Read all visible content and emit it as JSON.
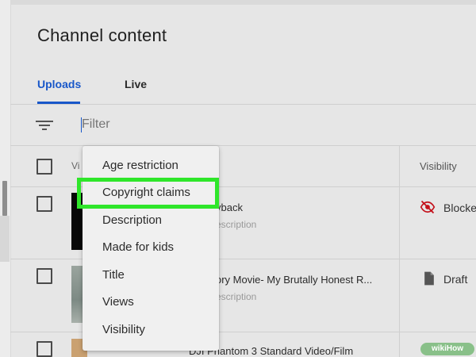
{
  "page": {
    "title": "Channel content"
  },
  "tabs": [
    {
      "label": "Uploads",
      "active": true
    },
    {
      "label": "Live",
      "active": false
    }
  ],
  "filter": {
    "placeholder": "Filter"
  },
  "table": {
    "headers": {
      "video": "Vi",
      "visibility": "Visibility"
    },
    "rows": [
      {
        "title": "yback",
        "description": "escription",
        "visibility": "Blocke",
        "visibility_icon": "eye-off-icon"
      },
      {
        "title": "ory Movie- My Brutally Honest R...",
        "description": "escription",
        "visibility": "Draft",
        "visibility_icon": "document-icon"
      },
      {
        "title": "DJI Phantom 3 Standard Video/Film",
        "description": "",
        "visibility": "",
        "visibility_icon": ""
      }
    ]
  },
  "dropdown": {
    "items": [
      "Age restriction",
      "Copyright claims",
      "Description",
      "Made for kids",
      "Title",
      "Views",
      "Visibility"
    ],
    "highlighted_index": 1
  },
  "watermark": {
    "text": "wikiHow"
  },
  "colors": {
    "accent": "#1857c9",
    "highlight": "#2fe62a",
    "blocked": "#c4121c",
    "background": "#e6e6e6"
  }
}
